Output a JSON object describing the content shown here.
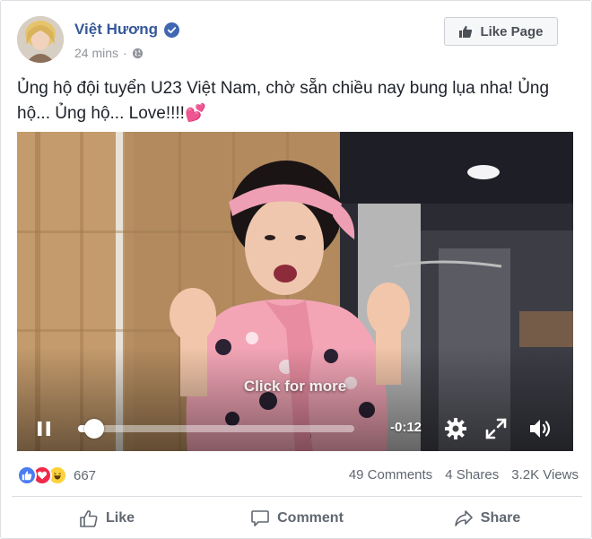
{
  "post": {
    "author": "Việt Hương",
    "timestamp": "24 mins",
    "separator": "·",
    "text": "Ủng hộ đội tuyển U23 Việt Nam, chờ sẵn chiều nay bung lụa nha! Ủng hộ... Ủng hộ... Love!!!!",
    "emoji": "💕"
  },
  "header": {
    "like_page_label": "Like Page"
  },
  "video": {
    "overlay_text": "Click for more",
    "time_remaining": "-0:12",
    "progress": 0.06
  },
  "stats": {
    "reaction_count": "667",
    "comments": "49 Comments",
    "shares": "4 Shares",
    "views": "3.2K Views"
  },
  "actions": {
    "like": "Like",
    "comment": "Comment",
    "share": "Share"
  },
  "icons": {
    "verified": "verified-badge-icon",
    "globe": "globe-icon",
    "thumb": "thumbs-up-icon",
    "pause": "pause-icon",
    "gear": "gear-icon",
    "expand": "expand-icon",
    "volume": "volume-icon",
    "love": "heart-icon",
    "haha": "laughing-face-icon",
    "comment": "speech-bubble-icon",
    "share": "share-arrow-icon"
  },
  "colors": {
    "name_link": "#365899",
    "like_reaction": "#4c7cf2",
    "love_reaction": "#f0284a",
    "haha_reaction": "#fcd13b",
    "muted_text": "#606770"
  }
}
